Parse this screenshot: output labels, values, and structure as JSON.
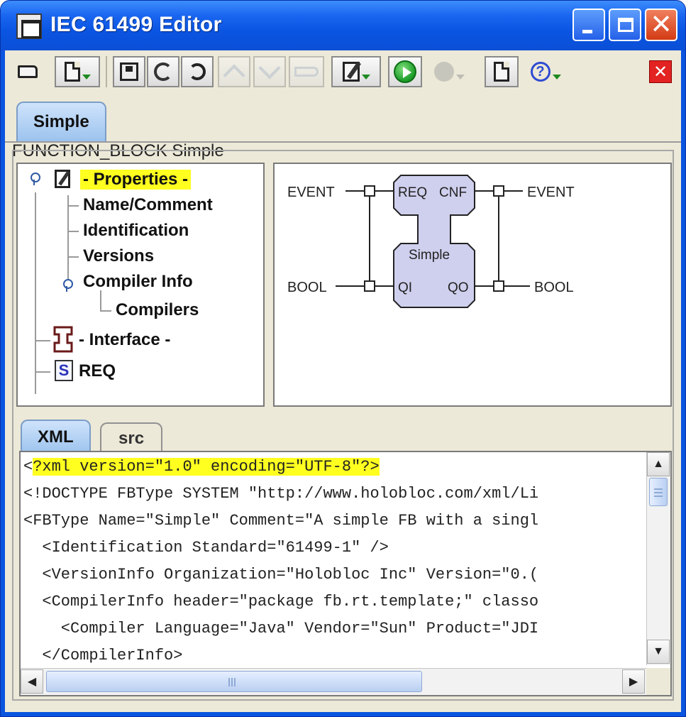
{
  "window": {
    "title": "IEC 61499 Editor"
  },
  "toolbar": {
    "buttons": [
      "open",
      "new",
      "save",
      "refresh",
      "undo",
      "move-up",
      "move-down",
      "insert",
      "edit",
      "run",
      "stop",
      "view",
      "help",
      "close"
    ]
  },
  "top_tabs": [
    {
      "label": "Simple",
      "active": true
    }
  ],
  "fb_header": "FUNCTION_BLOCK Simple",
  "tree": {
    "properties": "- Properties -",
    "name_comment": "Name/Comment",
    "identification": "Identification",
    "versions": "Versions",
    "compiler_info": "Compiler Info",
    "compilers": "Compilers",
    "interface": "- Interface -",
    "req": "REQ",
    "src_icon_letter": "S"
  },
  "diagram": {
    "event_in_type": "EVENT",
    "event_out_type": "EVENT",
    "data_in_type": "BOOL",
    "data_out_type": "BOOL",
    "event_in": "REQ",
    "event_out": "CNF",
    "data_in": "QI",
    "data_out": "QO",
    "block_name": "Simple",
    "block_fill": "#cfcfee"
  },
  "bottom_tabs": [
    {
      "label": "XML",
      "active": true
    },
    {
      "label": "src",
      "active": false
    }
  ],
  "code": {
    "line1_prefix": "<",
    "line1_highlight": "?xml version=\"1.0\" encoding=\"UTF-8\"?>",
    "lines": [
      "<!DOCTYPE FBType SYSTEM \"http://www.holobloc.com/xml/Li",
      "<FBType Name=\"Simple\" Comment=\"A simple FB with a singl",
      "  <Identification Standard=\"61499-1\" />",
      "  <VersionInfo Organization=\"Holobloc Inc\" Version=\"0.(",
      "  <CompilerInfo header=\"package fb.rt.template;\" classo",
      "    <Compiler Language=\"Java\" Vendor=\"Sun\" Product=\"JDI",
      "  </CompilerInfo>"
    ]
  },
  "colors": {
    "title_bar": "#0a55e2",
    "highlight": "#ffff20",
    "panel_bg": "#ece9d8"
  }
}
